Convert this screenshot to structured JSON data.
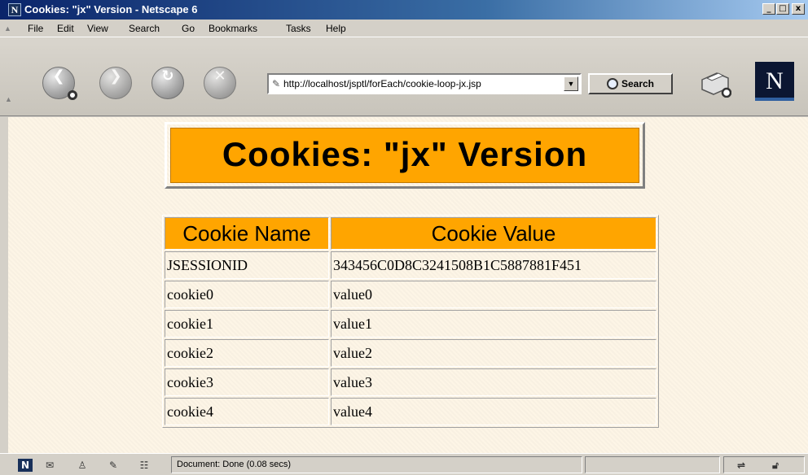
{
  "window": {
    "title": "Cookies: \"jx\" Version - Netscape 6",
    "logo_letter": "N",
    "controls": {
      "minimize": "_",
      "maximize": "□",
      "close": "x"
    }
  },
  "menu": {
    "items": [
      "File",
      "Edit",
      "View",
      "Search",
      "Go",
      "Bookmarks",
      "Tasks",
      "Help"
    ]
  },
  "toolbar": {
    "url": "http://localhost/jsptl/forEach/cookie-loop-jx.jsp",
    "search_label": "Search",
    "badge_letter": "N",
    "icons": [
      "back-icon",
      "forward-icon",
      "reload-icon",
      "stop-icon",
      "print-icon"
    ]
  },
  "page": {
    "heading": "Cookies: \"jx\" Version",
    "table": {
      "headers": [
        "Cookie Name",
        "Cookie Value"
      ],
      "rows": [
        [
          "JSESSIONID",
          "343456C0D8C3241508B1C5887881F451"
        ],
        [
          "cookie0",
          "value0"
        ],
        [
          "cookie1",
          "value1"
        ],
        [
          "cookie2",
          "value2"
        ],
        [
          "cookie3",
          "value3"
        ],
        [
          "cookie4",
          "value4"
        ]
      ]
    },
    "colors": {
      "accent": "#ffa500",
      "background": "#fdf5e6"
    }
  },
  "status": {
    "text": "Document: Done (0.08 secs)"
  }
}
